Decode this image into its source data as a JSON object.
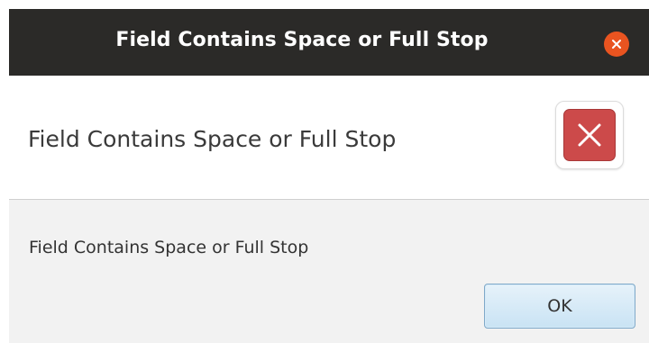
{
  "window": {
    "title": "Field Contains Space or Full Stop",
    "close_icon": "close-icon",
    "close_color": "#e95420"
  },
  "header": {
    "text": "Field Contains Space or Full Stop",
    "icon": "error-icon",
    "icon_color": "#cc4a4a"
  },
  "content": {
    "message": "Field Contains Space or Full Stop"
  },
  "buttons": {
    "ok_label": "OK"
  }
}
